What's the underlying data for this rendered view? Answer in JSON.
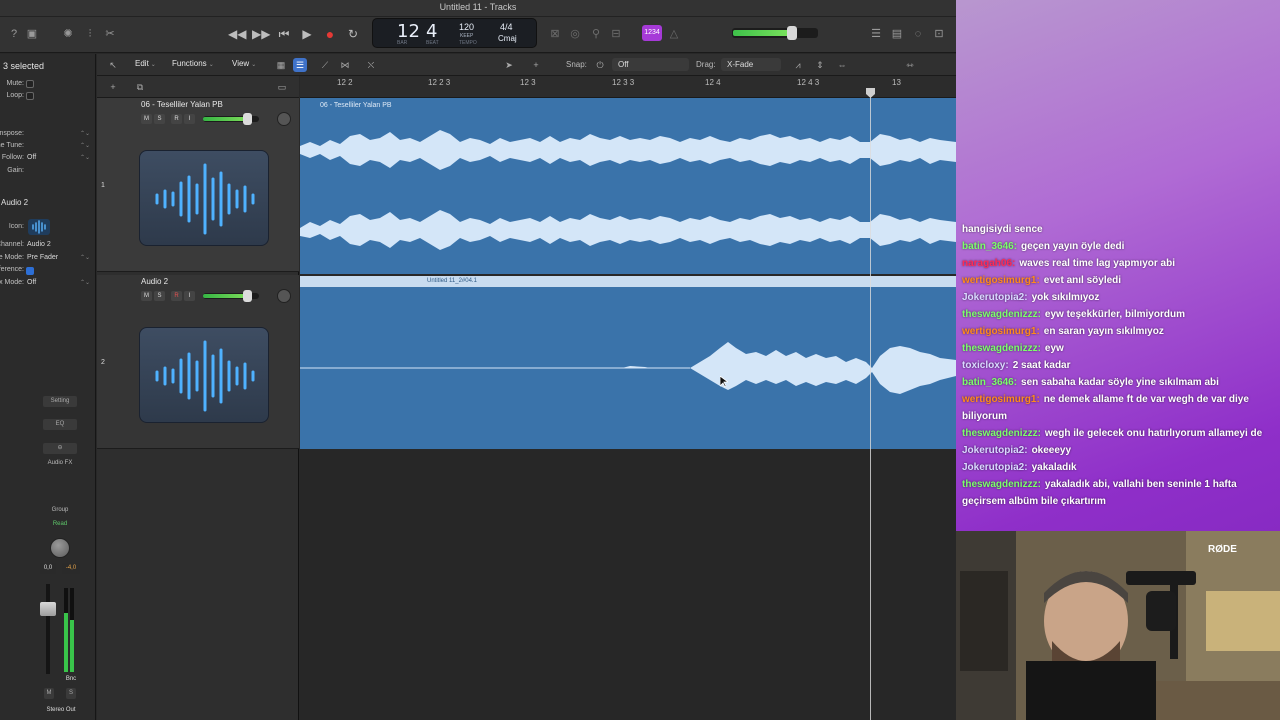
{
  "window": {
    "title": "Untitled 11 - Tracks"
  },
  "lcd": {
    "bar": "12",
    "beat": "4",
    "bar_label": "BAR",
    "beat_label": "BEAT",
    "tempo": "120",
    "tempo_mode": "KEEP",
    "tempo_label": "TEMPO",
    "signature": "4/4",
    "key": "Cmaj"
  },
  "master_badge": "1234",
  "master_volume_fraction": 0.72,
  "inspector": {
    "header": "3 selected",
    "rows": [
      {
        "key": "Mute:",
        "value": ""
      },
      {
        "key": "Loop:",
        "value": ""
      },
      {
        "key": "Transpose:",
        "value": ""
      },
      {
        "key": "Fine Tune:",
        "value": ""
      },
      {
        "key": "Flex & Follow:",
        "value": "Off"
      },
      {
        "key": "Gain:",
        "value": ""
      }
    ],
    "track_section": "Audio 2",
    "track_rows": [
      {
        "key": "Icon:",
        "value": ""
      },
      {
        "key": "Channel:",
        "value": "Audio 2"
      },
      {
        "key": "Freeze Mode:",
        "value": "Pre Fader"
      },
      {
        "key": "Q-Reference:",
        "value": ""
      },
      {
        "key": "Flex Mode:",
        "value": "Off"
      }
    ],
    "strip": {
      "setting": "Setting",
      "eq": "EQ",
      "audio_fx": "Audio FX",
      "group": "Group",
      "read": "Read",
      "vol_value": "0,0",
      "peak_value": "-4,0",
      "bnc": "Bnc",
      "mute": "M",
      "solo": "S",
      "output": "Stereo Out"
    }
  },
  "toolbar": {
    "edit": "Edit",
    "functions": "Functions",
    "view": "View",
    "snap_label": "Snap:",
    "snap_value": "Off",
    "drag_label": "Drag:",
    "drag_value": "X-Fade"
  },
  "ruler": {
    "labels": [
      "12 2",
      "12 2 3",
      "12 3",
      "12 3 3",
      "12 4",
      "12 4 3",
      "13"
    ]
  },
  "tracks": [
    {
      "number": "1",
      "name": "06 - Teselliler Yalan PB",
      "region_name": "06 - Teselliler Yalan PB",
      "volume_fraction": 0.8,
      "mute": "M",
      "solo": "S",
      "rec": "R",
      "input": "I"
    },
    {
      "number": "2",
      "name": "Audio 2",
      "region_name": "Untitled 11_2#04.1",
      "volume_fraction": 0.8,
      "mute": "M",
      "solo": "S",
      "rec": "R",
      "input": "I"
    }
  ],
  "chat": [
    {
      "user": "",
      "user_color": "#ffffff",
      "text": "hangisiydi sence"
    },
    {
      "user": "batin_3646:",
      "user_color": "#7CFF6B",
      "text": "geçen yayın öyle dedi"
    },
    {
      "user": "naragah06:",
      "user_color": "#ff2a55",
      "text": "waves real time lag yapmıyor abi"
    },
    {
      "user": "wertigosimurg1:",
      "user_color": "#ff8a1c",
      "text": "evet anıl söyledi"
    },
    {
      "user": "Jokerutopia2:",
      "user_color": "#d9d9ff",
      "text": "yok sıkılmıyoz"
    },
    {
      "user": "theswagdenizzz:",
      "user_color": "#7CFF6B",
      "text": "eyw teşekkürler, bilmiyordum"
    },
    {
      "user": "wertigosimurg1:",
      "user_color": "#ff8a1c",
      "text": "en saran yayın sıkılmıyoz"
    },
    {
      "user": "theswagdenizzz:",
      "user_color": "#7CFF6B",
      "text": "eyw"
    },
    {
      "user": "toxicloxy:",
      "user_color": "#d9d9ff",
      "text": "2 saat kadar"
    },
    {
      "user": "batin_3646:",
      "user_color": "#7CFF6B",
      "text": "sen sabaha kadar söyle yine sıkılmam abi"
    },
    {
      "user": "wertigosimurg1:",
      "user_color": "#ff8a1c",
      "text": "ne demek allame ft de var wegh de var diye biliyorum"
    },
    {
      "user": "theswagdenizzz:",
      "user_color": "#7CFF6B",
      "text": "wegh ile gelecek onu hatırlıyorum allameyi de"
    },
    {
      "user": "Jokerutopia2:",
      "user_color": "#d9d9ff",
      "text": "okeeeyy"
    },
    {
      "user": "Jokerutopia2:",
      "user_color": "#d9d9ff",
      "text": "yakaladık"
    },
    {
      "user": "theswagdenizzz:",
      "user_color": "#7CFF6B",
      "text": "yakaladık abi, vallahi ben seninle 1 hafta geçirsem albüm bile çıkartırım"
    }
  ],
  "webcam": {
    "mic_brand": "RØDE"
  }
}
